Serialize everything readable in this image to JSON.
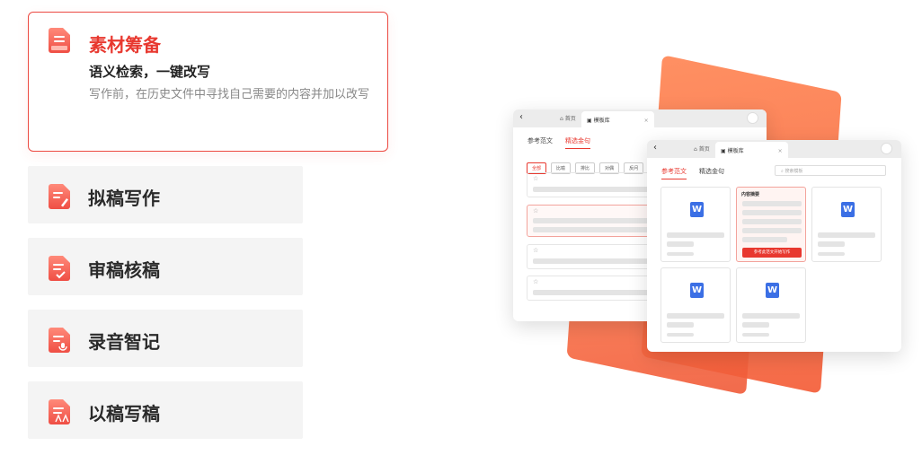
{
  "features": {
    "active": {
      "title": "素材筹备",
      "subtitle": "语义检索，一键改写",
      "description": "写作前，在历史文件中寻找自己需要的内容并加以改写",
      "icon": "document-icon"
    },
    "items": [
      {
        "label": "拟稿写作",
        "icon": "document-pen-icon"
      },
      {
        "label": "审稿核稿",
        "icon": "document-check-icon"
      },
      {
        "label": "录音智记",
        "icon": "document-mic-icon"
      },
      {
        "label": "以稿写稿",
        "icon": "document-copy-icon"
      }
    ]
  },
  "colors": {
    "accent": "#e8382f",
    "item_bg": "#f4f4f4",
    "word_blue": "#3b6fe5"
  },
  "illustration": {
    "back_window": {
      "home_label": "首页",
      "tab_label": "模板库",
      "tabs": [
        "参考范文",
        "精选金句"
      ],
      "chips": [
        "全部",
        "比喻",
        "排比",
        "对偶",
        "反问"
      ]
    },
    "front_window": {
      "home_label": "首页",
      "tab_label": "模板库",
      "tabs": [
        "参考范文",
        "精选金句"
      ],
      "search_placeholder": "搜索模板",
      "card_title": "内容摘要",
      "card_button": "参考此范文开始写作",
      "doc_glyph": "W"
    }
  }
}
